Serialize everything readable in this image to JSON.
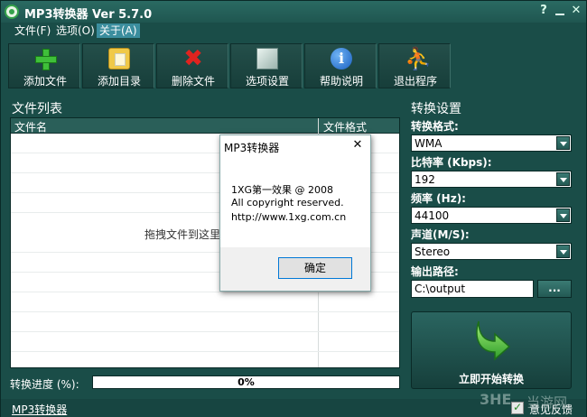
{
  "window": {
    "title": "MP3转换器 Ver 5.7.0"
  },
  "menu": [
    {
      "label": "文件(F)"
    },
    {
      "label": "选项(O)"
    },
    {
      "label": "关于(A)"
    }
  ],
  "toolbar": [
    {
      "label": "添加文件",
      "icon": "plus-icon"
    },
    {
      "label": "添加目录",
      "icon": "folder-icon"
    },
    {
      "label": "删除文件",
      "icon": "x-icon"
    },
    {
      "label": "选项设置",
      "icon": "box-icon"
    },
    {
      "label": "帮助说明",
      "icon": "info-icon"
    },
    {
      "label": "退出程序",
      "icon": "exit-icon"
    }
  ],
  "filelist": {
    "title": "文件列表",
    "columns": [
      "文件名",
      "文件格式"
    ],
    "drop_hint": "拖拽文件到这里"
  },
  "progress": {
    "label": "转换进度 (%):",
    "value": 0,
    "text": "0%"
  },
  "settings": {
    "title": "转换设置",
    "format_label": "转换格式:",
    "format_value": "WMA",
    "bitrate_label": "比特率 (Kbps):",
    "bitrate_value": "192",
    "samplerate_label": "频率 (Hz):",
    "samplerate_value": "44100",
    "channel_label": "声道(M/S):",
    "channel_value": "Stereo",
    "output_label": "输出路径:",
    "output_value": "C:\\output",
    "browse_label": "...",
    "start_label": "立即开始转换"
  },
  "statusbar": {
    "link": "MP3转换器",
    "feedback": "意见反馈"
  },
  "dialog": {
    "title": "MP3转换器",
    "lines": [
      "1XG第一效果 @ 2008",
      "All copyright reserved.",
      "http://www.1xg.com.cn"
    ],
    "ok_label": "确定"
  },
  "watermark": {
    "logo": "3HE",
    "text": "当游网"
  },
  "colors": {
    "background": "#1a4d48",
    "accent": "#3fb14a",
    "progress_fill": "#3fb14a"
  }
}
